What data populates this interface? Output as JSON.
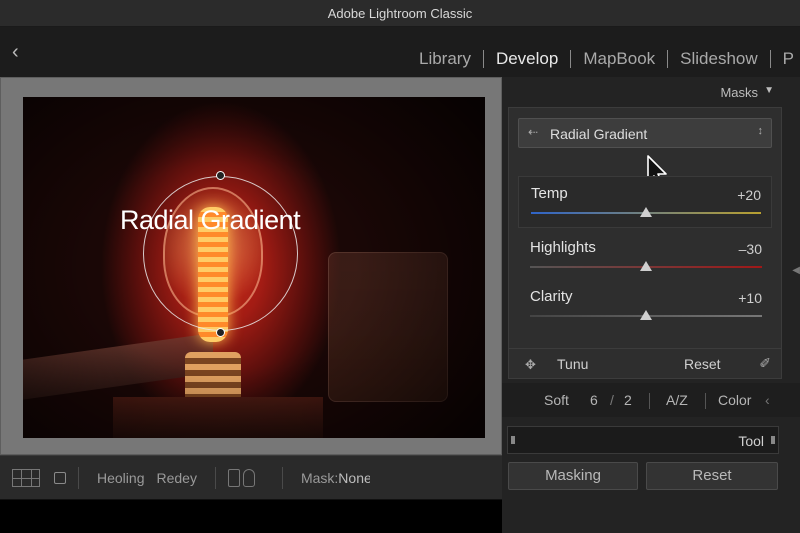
{
  "window": {
    "title": "Adobe Lightroom Classic"
  },
  "nav": {
    "back_icon": "chevron-left-icon",
    "modules": [
      {
        "label": "Library",
        "active": false
      },
      {
        "label": "Develop",
        "active": true
      },
      {
        "label": "MapBook",
        "active": false
      },
      {
        "label": "Slideshow",
        "active": false
      },
      {
        "label": "P",
        "active": false
      }
    ]
  },
  "canvas": {
    "overlay_label": "Radial Gradient"
  },
  "toolbar": {
    "healing_label": "Heoling",
    "redeye_label": "Redey",
    "mask_label": "Mask:",
    "mask_value": "None"
  },
  "panel": {
    "header_label": "Masks",
    "mask_selector": "Radial Gradient",
    "sliders": [
      {
        "name": "Temp",
        "value": "+20",
        "position": 0.5,
        "gradient": [
          "#2f64c8",
          "#b8a030"
        ]
      },
      {
        "name": "Highlights",
        "value": "–30",
        "position": 0.5,
        "gradient": [
          "#555555",
          "#a01818"
        ]
      },
      {
        "name": "Clarity",
        "value": "+10",
        "position": 0.5,
        "gradient": [
          "#444444",
          "#777777"
        ]
      }
    ],
    "tune": {
      "label": "Tunu",
      "reset": "Reset"
    },
    "sort": {
      "soft": "Soft",
      "n1": "6",
      "slash": "/",
      "n2": "2",
      "az": "A/Z",
      "color": "Color"
    },
    "tool_label": "Tool",
    "masking_button": "Masking",
    "reset_button": "Reset"
  },
  "colors": {
    "accent": "#e8e8e8",
    "panel": "#232323",
    "glow": "#c8241a"
  }
}
